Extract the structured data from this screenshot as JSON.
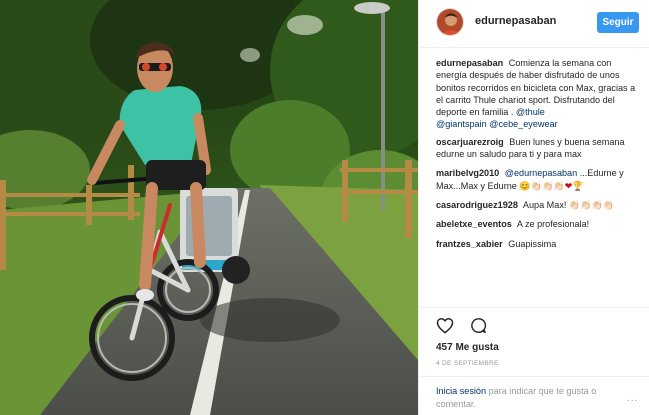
{
  "post": {
    "username": "edurnepasaban",
    "follow_label": "Seguir",
    "avatar_icon": "profile-photo-avatar"
  },
  "comments": [
    {
      "user": "edurnepasaban",
      "text1": "Comienza la semana con energía después de haber disfrutado de unos bonitos recorridos en bicicleta con Max, gracias a el carrito Thule chariot sport. Disfrutando del deporte en familia .",
      "mention1": "@thule",
      "mention2": "@giantspain",
      "mention3": "@cebe_eyewear"
    },
    {
      "user": "oscarjuarezroig",
      "text1": "Buen lunes y buena semana edurne un saludo para ti y para max"
    },
    {
      "user": "maribelvg2010",
      "mention1": "@edurnepasaban",
      "text1": "...Edurne y Max...Max y Edurne",
      "emoji": "😊👏🏻👏🏻👏🏻",
      "heart": "❤",
      "trophy": "🏆"
    },
    {
      "user": "casarodriguez1928",
      "text1": "Aupa Max! 👏🏻👏🏻👏🏻👏🏻"
    },
    {
      "user": "abeletxe_eventos",
      "text1": "A ze profesionala!"
    },
    {
      "user": "frantzes_xabier",
      "text1": "Guapissima"
    }
  ],
  "actions": {
    "like_icon": "heart-outline-icon",
    "comment_icon": "comment-bubble-icon",
    "likes": "457 Me gusta",
    "date": "4 DE SEPTIEMBRE",
    "login_link": "Inicia sesión",
    "login_text": "para indicar que te gusta o comentar.",
    "more_icon": "more-options-icon",
    "more_glyph": "..."
  },
  "colors": {
    "follow_button": "#3897f0",
    "mention": "#003569",
    "username": "#262626",
    "muted": "#999999"
  }
}
